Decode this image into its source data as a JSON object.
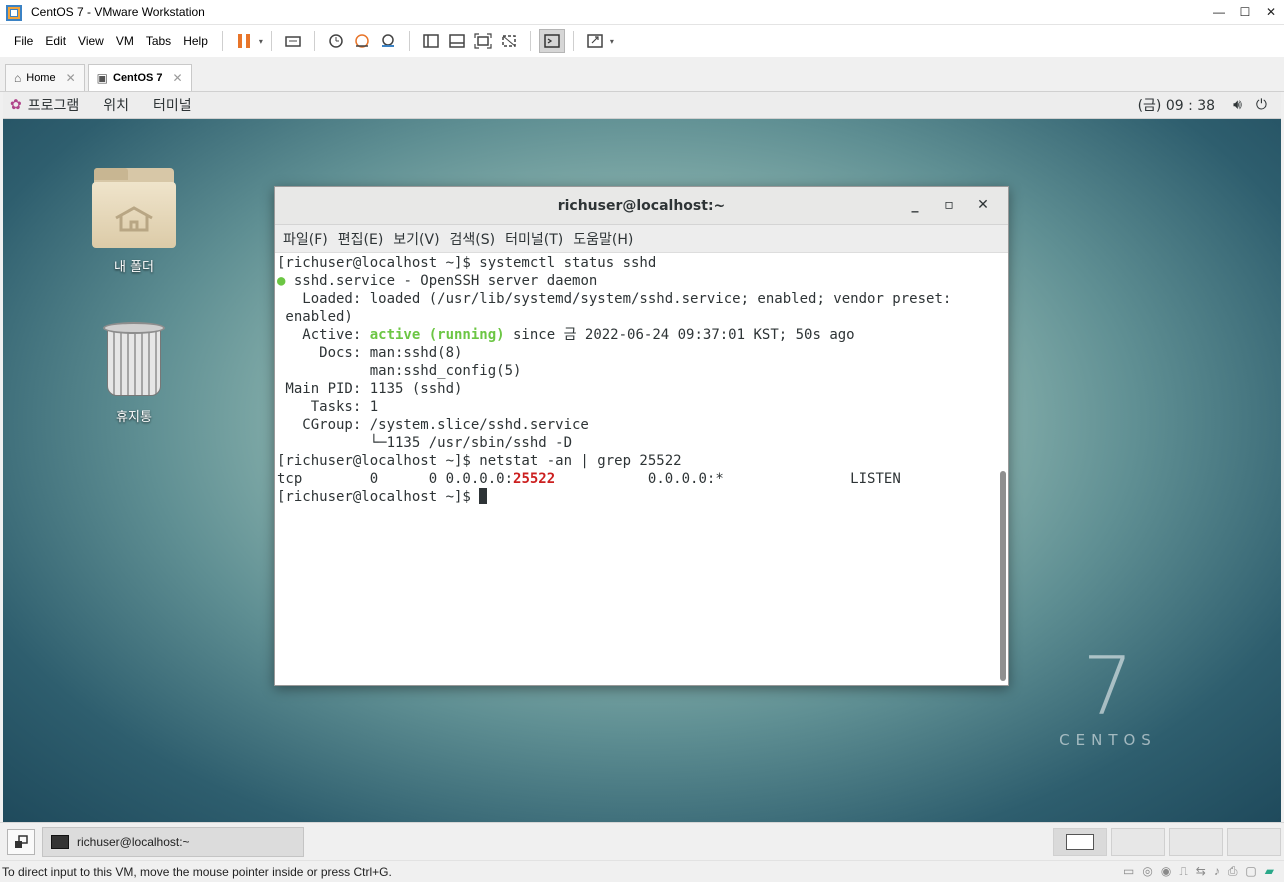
{
  "window": {
    "title": "CentOS 7 - VMware Workstation",
    "controls": [
      "—",
      "☐",
      "✕"
    ]
  },
  "menubar": {
    "items": [
      "File",
      "Edit",
      "View",
      "VM",
      "Tabs",
      "Help"
    ]
  },
  "toolbar": {
    "caret": "▾"
  },
  "tabs": [
    {
      "label": "Home",
      "icon": "home-icon",
      "close": "✕"
    },
    {
      "label": "CentOS 7",
      "icon": "vm-icon",
      "close": "✕"
    }
  ],
  "gnome": {
    "apps_label": "프로그램",
    "places_label": "위치",
    "terminal_label": "터미널",
    "clock": "(금) 09 : 38"
  },
  "desktop": {
    "home_folder_label": "내 폴더",
    "trash_label": "휴지통"
  },
  "branding": {
    "seven": "7",
    "word": "CENTOS"
  },
  "terminal": {
    "title": "richuser@localhost:~",
    "menus": [
      "파일(F)",
      "편집(E)",
      "보기(V)",
      "검색(S)",
      "터미널(T)",
      "도움말(H)"
    ],
    "lines": {
      "l1": "[richuser@localhost ~]$ systemctl status sshd",
      "l2_dot": "●",
      "l2": " sshd.service - OpenSSH server daemon",
      "l3": "   Loaded: loaded (/usr/lib/systemd/system/sshd.service; enabled; vendor preset:",
      "l4": " enabled)",
      "l5_pre": "   Active: ",
      "l5_status": "active (running)",
      "l5_post": " since 금 2022-06-24 09:37:01 KST; 50s ago",
      "l6": "     Docs: man:sshd(8)",
      "l7": "           man:sshd_config(5)",
      "l8": " Main PID: 1135 (sshd)",
      "l9": "    Tasks: 1",
      "l10": "   CGroup: /system.slice/sshd.service",
      "l11": "           └─1135 /usr/sbin/sshd -D",
      "l12": "[richuser@localhost ~]$ netstat -an | grep 25522",
      "l13_pre": "tcp        0      0 0.0.0.0:",
      "l13_port": "25522",
      "l13_post": "           0.0.0.0:*               LISTEN",
      "l14": "[richuser@localhost ~]$ "
    }
  },
  "taskbar": {
    "item_label": "richuser@localhost:~"
  },
  "status": {
    "message": "To direct input to this VM, move the mouse pointer inside or press Ctrl+G."
  }
}
